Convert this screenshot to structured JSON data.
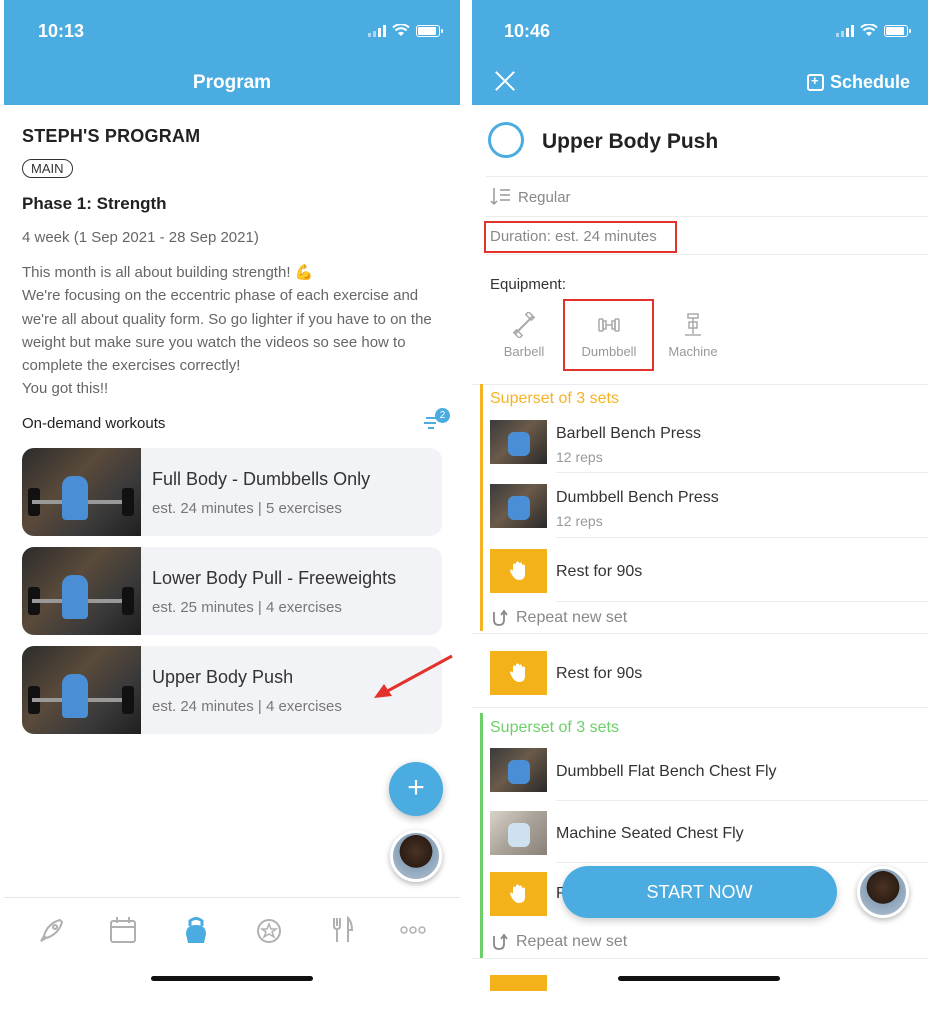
{
  "left": {
    "status_time": "10:13",
    "nav_title": "Program",
    "program_title": "STEPH'S PROGRAM",
    "badge": "MAIN",
    "phase": "Phase 1: Strength",
    "dates": "4 week (1 Sep 2021 - 28 Sep 2021)",
    "description": "This month is all about building strength! 💪\nWe're focusing on the eccentric phase of each exercise and we're all about quality form. So go lighter if you have to on the weight but make sure you watch the videos so see how to complete the exercises correctly!\nYou got this!!",
    "on_demand_label": "On-demand workouts",
    "filter_count": "2",
    "workouts": [
      {
        "title": "Full Body - Dumbbells Only",
        "meta": "est. 24 minutes | 5 exercises"
      },
      {
        "title": "Lower Body Pull - Freeweights",
        "meta": "est. 25 minutes | 4 exercises"
      },
      {
        "title": "Upper Body Push",
        "meta": "est. 24 minutes | 4 exercises"
      }
    ],
    "fab_label": "+",
    "tabs": [
      "rocket-icon",
      "calendar-icon",
      "kettlebell-icon",
      "badge-star-icon",
      "fork-knife-icon",
      "more-icon"
    ]
  },
  "right": {
    "status_time": "10:46",
    "schedule_label": "Schedule",
    "workout_title": "Upper Body Push",
    "mode": "Regular",
    "duration": "Duration: est. 24 minutes",
    "equipment_label": "Equipment:",
    "equipment": [
      "Barbell",
      "Dumbbell",
      "Machine"
    ],
    "superset1": {
      "title": "Superset of 3 sets",
      "color": "#f5b324",
      "items": [
        {
          "name": "Barbell Bench Press",
          "sub": "12 reps"
        },
        {
          "name": "Dumbbell Bench Press",
          "sub": "12 reps"
        },
        {
          "name": "Rest for 90s"
        }
      ],
      "repeat": "Repeat new set"
    },
    "rest_between": "Rest for 90s",
    "superset2": {
      "title": "Superset of 3 sets",
      "color": "#6dcf6a",
      "items": [
        {
          "name": "Dumbbell Flat Bench Chest Fly"
        },
        {
          "name": "Machine Seated Chest Fly"
        },
        {
          "name": "R"
        }
      ],
      "repeat": "Repeat new set"
    },
    "start_button": "START NOW"
  },
  "colors": {
    "primary": "#4aace0",
    "annotation": "#e2322b",
    "rest": "#f3b219"
  }
}
